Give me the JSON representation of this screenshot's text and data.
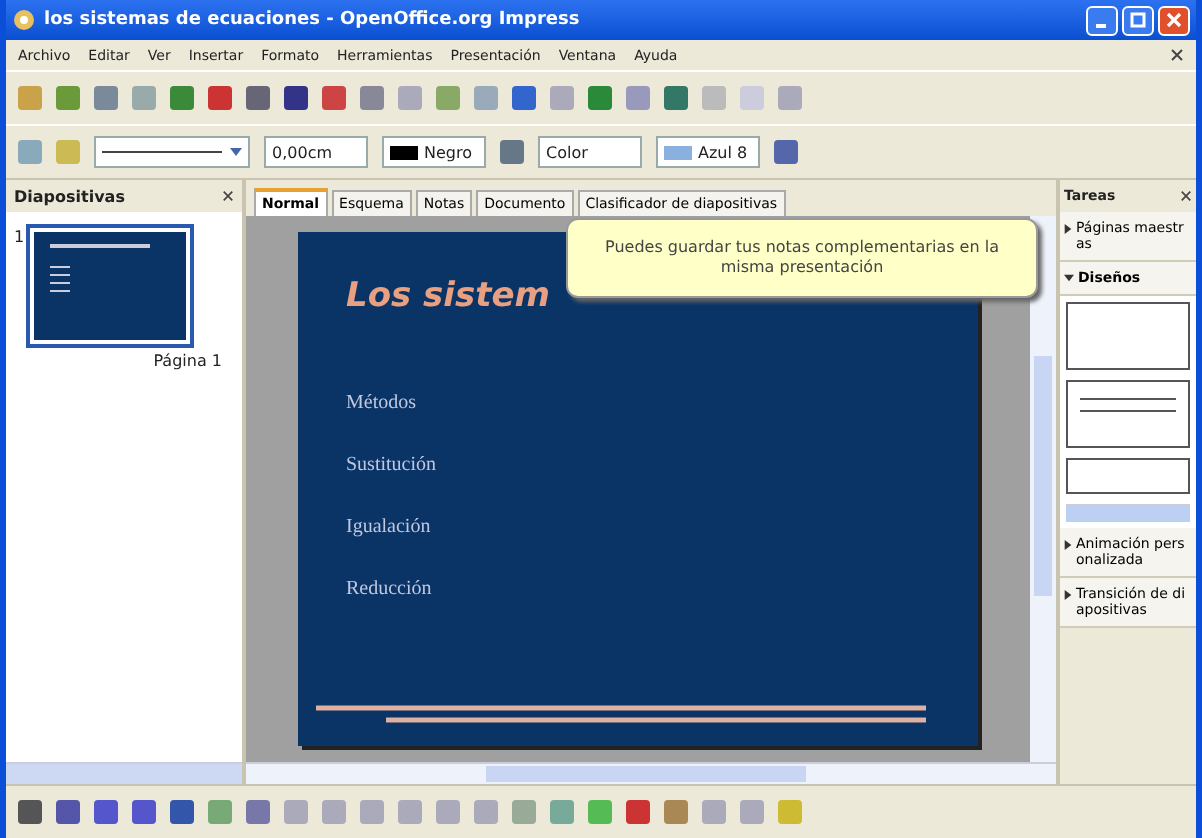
{
  "window": {
    "title": "los sistemas de ecuaciones - OpenOffice.org Impress"
  },
  "menu": [
    "Archivo",
    "Editar",
    "Ver",
    "Insertar",
    "Formato",
    "Herramientas",
    "Presentación",
    "Ventana",
    "Ayuda"
  ],
  "line_toolbar": {
    "line_width": "0,00cm",
    "line_color": "Negro",
    "fill_type": "Color",
    "fill_color": "Azul 8"
  },
  "slides_panel": {
    "title": "Diapositivas",
    "slides": [
      {
        "number": "1",
        "label": "Página 1",
        "selected": true
      }
    ]
  },
  "tabs": [
    {
      "label": "Normal",
      "selected": true
    },
    {
      "label": "Esquema",
      "selected": false
    },
    {
      "label": "Notas",
      "selected": false
    },
    {
      "label": "Documento",
      "selected": false
    },
    {
      "label": "Clasificador de diapositivas",
      "selected": false
    }
  ],
  "slide": {
    "title": "Los sistem",
    "bullets": [
      "Métodos",
      "Sustitución",
      "Igualación",
      "Reducción"
    ]
  },
  "tooltip": "Puedes guardar tus notas complementarias en la misma presentación",
  "tasks_panel": {
    "title": "Tareas",
    "sections": [
      {
        "label": "Páginas maestras",
        "expanded": false
      },
      {
        "label": "Diseños",
        "expanded": true
      },
      {
        "label": "Animación personalizada",
        "expanded": false
      },
      {
        "label": "Transición de diapositivas",
        "expanded": false
      }
    ]
  }
}
